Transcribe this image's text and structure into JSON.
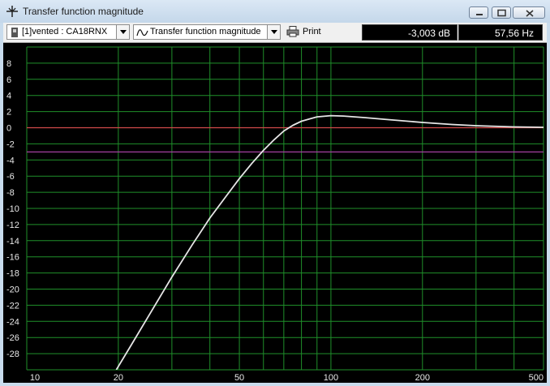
{
  "window": {
    "title": "Transfer function magnitude"
  },
  "toolbar": {
    "project_label": "[1]vented : CA18RNX",
    "view_label": "Transfer function magnitude",
    "print_label": "Print",
    "readout_db": "-3,003 dB",
    "readout_hz": "57,56 Hz"
  },
  "chart_data": {
    "type": "line",
    "title": "",
    "xlabel": "",
    "ylabel": "",
    "x_scale": "log",
    "xlim": [
      10,
      500
    ],
    "ylim": [
      -30,
      10
    ],
    "grid": true,
    "y_ticks": [
      "8",
      "6",
      "4",
      "2",
      "0",
      "-2",
      "-4",
      "-6",
      "-8",
      "-10",
      "-12",
      "-14",
      "-16",
      "-18",
      "-20",
      "-22",
      "-24",
      "-26",
      "-28"
    ],
    "x_tick_labels": [
      "10",
      "20",
      "50",
      "100",
      "200",
      "500"
    ],
    "reference_lines": [
      {
        "name": "0 dB",
        "y": 0,
        "color": "#d24a4a"
      },
      {
        "name": "-3 dB",
        "y": -3,
        "color": "#a43fa0"
      }
    ],
    "series": [
      {
        "color": "#e6e6e6",
        "x": [
          19.7,
          22,
          25,
          30,
          35,
          40,
          45,
          50,
          55,
          60,
          65,
          70,
          75,
          80,
          90,
          100,
          110,
          130,
          150,
          200,
          250,
          300,
          400,
          500
        ],
        "y": [
          -30,
          -27,
          -23.5,
          -18.5,
          -14.5,
          -11.2,
          -8.6,
          -6.3,
          -4.4,
          -2.8,
          -1.5,
          -0.4,
          0.3,
          0.8,
          1.35,
          1.5,
          1.45,
          1.25,
          1.05,
          0.65,
          0.4,
          0.25,
          0.1,
          0.05
        ]
      }
    ]
  }
}
